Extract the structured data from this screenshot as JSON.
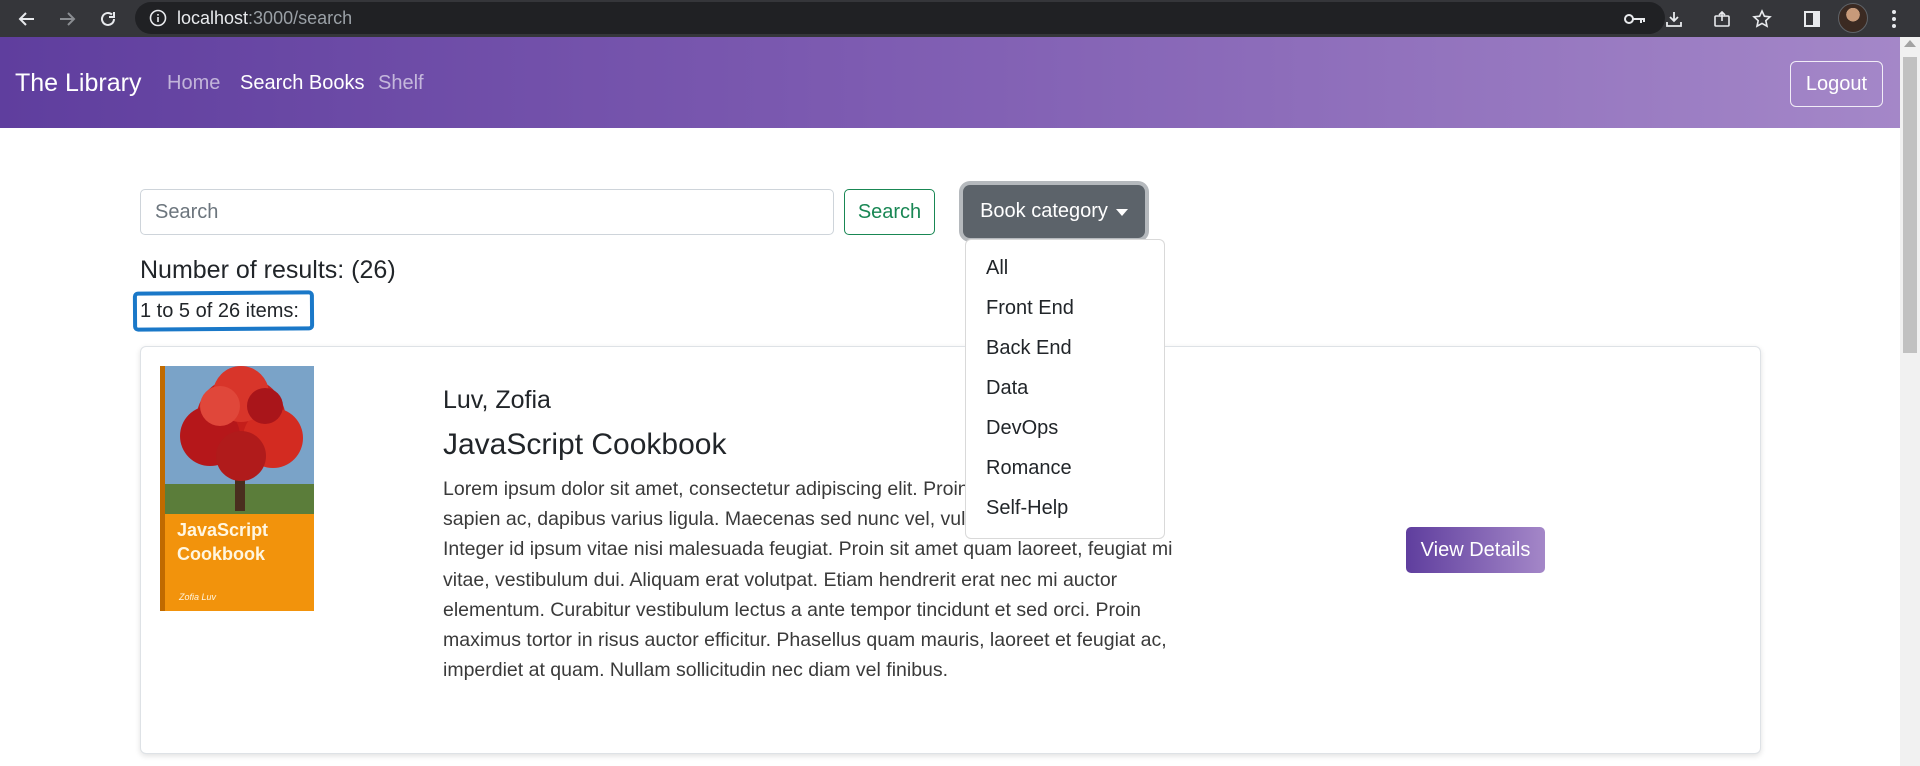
{
  "browser": {
    "url_host": "localhost",
    "url_path": ":3000/search"
  },
  "navbar": {
    "brand": "The Library",
    "links": [
      {
        "label": "Home",
        "active": false
      },
      {
        "label": "Search Books",
        "active": true
      },
      {
        "label": "Shelf",
        "active": false
      }
    ],
    "logout_label": "Logout"
  },
  "search": {
    "placeholder": "Search",
    "value": "",
    "button_label": "Search",
    "category_label": "Book category"
  },
  "dropdown": {
    "items": [
      "All",
      "Front End",
      "Back End",
      "Data",
      "DevOps",
      "Romance",
      "Self-Help"
    ]
  },
  "results": {
    "count_text": "Number of results: (26)",
    "range_text": "1 to 5 of 26 items:"
  },
  "book": {
    "author": "Luv, Zofia",
    "title": "JavaScript Cookbook",
    "description": "Lorem ipsum dolor sit amet, consectetur adipiscing elit. Proin condimentum eget sapien ac, dapibus varius ligula. Maecenas sed nunc vel, vulputate eleifend dui. Integer id ipsum vitae nisi malesuada feugiat. Proin sit amet quam laoreet, feugiat mi vitae, vestibulum dui. Aliquam erat volutpat. Etiam hendrerit erat nec mi auctor elementum. Curabitur vestibulum lectus a ante tempor tincidunt et sed orci. Proin maximus tortor in risus auctor efficitur. Phasellus quam mauris, laoreet et feugiat ac, imperdiet at quam. Nullam sollicitudin nec diam vel finibus.",
    "cover_title": "JavaScript Cookbook",
    "cover_author": "Zofia Luv",
    "button_label": "View Details"
  },
  "colors": {
    "navbar_gradient_start": "#5f3e9e",
    "navbar_gradient_end": "#a487c8",
    "success": "#198754",
    "secondary": "#5c636a",
    "annotation": "#1a78c8"
  }
}
